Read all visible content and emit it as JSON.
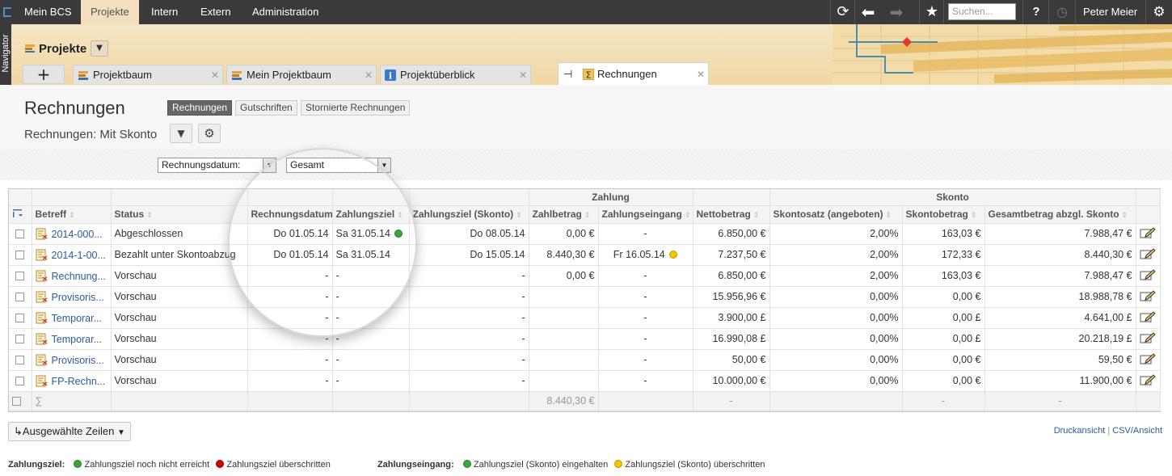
{
  "topbar": {
    "nav": [
      "Mein BCS",
      "Projekte",
      "Intern",
      "Extern",
      "Administration"
    ],
    "search_placeholder": "Suchen...",
    "help": "?",
    "user": "Peter Meier"
  },
  "navigator_label": "Navigator",
  "header": {
    "title": "Projekte",
    "tabs": [
      "Projektbaum",
      "Mein Projektbaum",
      "Projektüberblick",
      "Rechnungen"
    ]
  },
  "page": {
    "title": "Rechnungen",
    "segments": [
      "Rechnungen",
      "Gutschriften",
      "Stornierte Rechnungen"
    ],
    "view_title": "Rechnungen: Mit Skonto"
  },
  "filter": {
    "field": "Rechnungsdatum:",
    "range": "Gesamt"
  },
  "table": {
    "groups": {
      "zahlung": "Zahlung",
      "skonto": "Skonto"
    },
    "columns": [
      "Betreff",
      "Status",
      "Rechnungsdatum",
      "Zahlungsziel",
      "Zahlungsziel (Skonto)",
      "Zahlbetrag",
      "Zahlungseingang",
      "Nettobetrag",
      "Skontosatz (angeboten)",
      "Skontobetrag",
      "Gesamtbetrag abzgl. Skonto"
    ],
    "rows": [
      {
        "betreff": "2014-000...",
        "status": "Abgeschlossen",
        "rechnungsdatum": "Do 01.05.14",
        "zahlungsziel": "Sa 31.05.14",
        "ziel_dot": "green",
        "ziel_skonto": "Do 08.05.14",
        "zahlbetrag": "0,00 €",
        "eingang": "-",
        "eingang_dot": "",
        "netto": "6.850,00 €",
        "satz": "2,00%",
        "skontobetrag": "163,03 €",
        "gesamt": "7.988,47 €"
      },
      {
        "betreff": "2014-1-00...",
        "status": "Bezahlt unter Skontoabzug",
        "rechnungsdatum": "Do 01.05.14",
        "zahlungsziel": "Sa 31.05.14",
        "ziel_dot": "",
        "ziel_skonto": "Do 15.05.14",
        "zahlbetrag": "8.440,30 €",
        "eingang": "Fr 16.05.14",
        "eingang_dot": "yellow",
        "netto": "7.237,50 €",
        "satz": "2,00%",
        "skontobetrag": "172,33 €",
        "gesamt": "8.440,30 €"
      },
      {
        "betreff": "Rechnung...",
        "status": "Vorschau",
        "rechnungsdatum": "-",
        "zahlungsziel": "-",
        "ziel_dot": "",
        "ziel_skonto": "-",
        "zahlbetrag": "0,00 €",
        "eingang": "-",
        "eingang_dot": "",
        "netto": "6.850,00 €",
        "satz": "2,00%",
        "skontobetrag": "163,03 €",
        "gesamt": "7.988,47 €"
      },
      {
        "betreff": "Provisoris...",
        "status": "Vorschau",
        "rechnungsdatum": "-",
        "zahlungsziel": "-",
        "ziel_dot": "",
        "ziel_skonto": "-",
        "zahlbetrag": "",
        "eingang": "-",
        "eingang_dot": "",
        "netto": "15.956,96 €",
        "satz": "0,00%",
        "skontobetrag": "0,00 €",
        "gesamt": "18.988,78 €"
      },
      {
        "betreff": "Temporar...",
        "status": "Vorschau",
        "rechnungsdatum": "-",
        "zahlungsziel": "-",
        "ziel_dot": "",
        "ziel_skonto": "-",
        "zahlbetrag": "",
        "eingang": "-",
        "eingang_dot": "",
        "netto": "3.900,00 £",
        "satz": "0,00%",
        "skontobetrag": "0,00 £",
        "gesamt": "4.641,00 £"
      },
      {
        "betreff": "Temporar...",
        "status": "Vorschau",
        "rechnungsdatum": "-",
        "zahlungsziel": "-",
        "ziel_dot": "",
        "ziel_skonto": "-",
        "zahlbetrag": "",
        "eingang": "-",
        "eingang_dot": "",
        "netto": "16.990,08 £",
        "satz": "0,00%",
        "skontobetrag": "0,00 £",
        "gesamt": "20.218,19 £"
      },
      {
        "betreff": "Provisoris...",
        "status": "Vorschau",
        "rechnungsdatum": "-",
        "zahlungsziel": "-",
        "ziel_dot": "",
        "ziel_skonto": "-",
        "zahlbetrag": "",
        "eingang": "-",
        "eingang_dot": "",
        "netto": "50,00 €",
        "satz": "0,00%",
        "skontobetrag": "0,00 €",
        "gesamt": "59,50 €"
      },
      {
        "betreff": "FP-Rechn...",
        "status": "Vorschau",
        "rechnungsdatum": "-",
        "zahlungsziel": "-",
        "ziel_dot": "",
        "ziel_skonto": "-",
        "zahlbetrag": "",
        "eingang": "-",
        "eingang_dot": "",
        "netto": "10.000,00 €",
        "satz": "0,00%",
        "skontobetrag": "0,00 €",
        "gesamt": "11.900,00 €"
      }
    ],
    "sum": {
      "symbol": "∑",
      "zahlbetrag": "8.440,30 €",
      "netto": "-",
      "skontobetrag": "-",
      "gesamt": "-"
    }
  },
  "footer": {
    "bulk_button": "Ausgewählte Zeilen",
    "print_link": "Druckansicht",
    "link_sep": "|",
    "csv_link": "CSV/Ansicht"
  },
  "legend": {
    "ziel_label": "Zahlungsziel:",
    "ziel_green": "Zahlungsziel noch nicht erreicht",
    "ziel_red": "Zahlungsziel überschritten",
    "eingang_label": "Zahlungseingang:",
    "eingang_green": "Zahlungsziel (Skonto) eingehalten",
    "eingang_yellow": "Zahlungsziel (Skonto) überschritten"
  },
  "colors": {
    "topbar": "#3a3a3a",
    "active_tab": "#f3dfbe",
    "link": "#2d5b9a",
    "dot_green": "#3ca53c",
    "dot_yellow": "#f0c800",
    "dot_red": "#d80000"
  }
}
